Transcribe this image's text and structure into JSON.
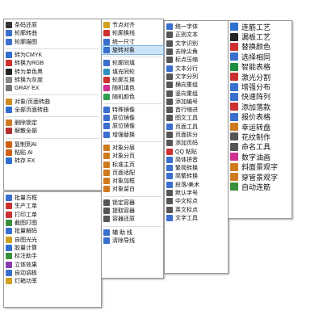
{
  "menu1": {
    "items": [
      {
        "label": "条码还原",
        "icon": "barcode-icon",
        "color": "#333333"
      },
      {
        "label": "轮廓转曲",
        "icon": "curve-icon",
        "color": "#3a6fcf"
      },
      {
        "label": "轮廓描图",
        "icon": "trace-icon",
        "color": "#3a6fcf"
      },
      {
        "label": "转为CMYK",
        "icon": "cmyk-icon",
        "color": "#2f6fd0"
      },
      {
        "label": "转换为RGB",
        "icon": "rgb-icon",
        "color": "#d03030"
      },
      {
        "label": "转为单色黑",
        "icon": "black-icon",
        "color": "#222222"
      },
      {
        "label": "转换为灰度",
        "icon": "gray-icon",
        "color": "#888888"
      },
      {
        "label": "GRAY EX",
        "icon": "gray-ex-icon",
        "color": "#777777"
      },
      {
        "label": "对象/页面转曲",
        "icon": "convert-icon",
        "color": "#d08a20"
      },
      {
        "label": "全部页面转曲",
        "icon": "pages-icon",
        "color": "#2f6fd0"
      },
      {
        "label": "删除锁定",
        "icon": "unlock-icon",
        "color": "#d07a20"
      },
      {
        "label": "解散全部",
        "icon": "ungroup-icon",
        "color": "#b03030"
      },
      {
        "label": "复制到AI",
        "icon": "ai-copy-icon",
        "color": "#d06010"
      },
      {
        "label": "粘贴  AI",
        "icon": "ai-paste-icon",
        "color": "#d06010"
      },
      {
        "label": "转存  EX",
        "icon": "export-icon",
        "color": "#2f6fd0"
      }
    ]
  },
  "menu1b": {
    "items": [
      {
        "label": "批量方框",
        "icon": "box-icon",
        "color": "#3a6fcf"
      },
      {
        "label": "生产工单",
        "icon": "order-icon",
        "color": "#cc3030"
      },
      {
        "label": "打印工单",
        "icon": "print-icon",
        "color": "#cc3030"
      },
      {
        "label": "截图打图",
        "icon": "screenshot-icon",
        "color": "#3a8f3a"
      },
      {
        "label": "批量解码",
        "icon": "decode-icon",
        "color": "#3a6fcf"
      },
      {
        "label": "自图光光",
        "icon": "light-icon",
        "color": "#d0a020"
      },
      {
        "label": "胶量计算",
        "icon": "calc-icon",
        "color": "#2f6fd0"
      },
      {
        "label": "标注助手",
        "icon": "annotate-icon",
        "color": "#3a8f3a"
      },
      {
        "label": "立体效果",
        "icon": "3d-icon",
        "color": "#8a3ab0"
      },
      {
        "label": "自动调板",
        "icon": "hourglass-icon",
        "color": "#3a6fcf"
      },
      {
        "label": "灯箱功率",
        "icon": "lamp-icon",
        "color": "#d0a020"
      }
    ]
  },
  "menu2": {
    "items": [
      {
        "label": "节点对齐",
        "icon": "node-align-icon",
        "color": "#d0a020"
      },
      {
        "label": "轮廓换线",
        "icon": "outline-icon",
        "color": "#cc3030"
      },
      {
        "label": "统一尺寸",
        "icon": "size-icon",
        "color": "#3a6fcf"
      },
      {
        "label": "旋转对象",
        "icon": "rotate-icon",
        "color": "#3a6fcf"
      },
      {
        "label": "轮廓同填",
        "icon": "fill-outline-icon",
        "color": "#3a6fcf"
      },
      {
        "label": "填充同轮",
        "icon": "fill-icon",
        "color": "#2f8fc0"
      },
      {
        "label": "轮廓互换",
        "icon": "swap-icon",
        "color": "#cc3030"
      },
      {
        "label": "随机填色",
        "icon": "random-fill-icon",
        "color": "#d03090"
      },
      {
        "label": "随机颜色",
        "icon": "random-color-icon",
        "color": "#30a050"
      },
      {
        "label": "特殊镜像",
        "icon": "mirror-icon",
        "color": "#3a6fcf"
      },
      {
        "label": "原位镜像",
        "icon": "mirror2-icon",
        "color": "#3a6fcf"
      },
      {
        "label": "原位镜像",
        "icon": "mirror3-icon",
        "color": "#3a6fcf"
      },
      {
        "label": "增强替换",
        "icon": "replace-icon",
        "color": "#3a6fcf"
      },
      {
        "label": "对象分层",
        "icon": "layer-icon",
        "color": "#d07a20"
      },
      {
        "label": "对象分页",
        "icon": "page-split-icon",
        "color": "#d07a20"
      },
      {
        "label": "标准主页",
        "icon": "home-page-icon",
        "color": "#d07a20"
      },
      {
        "label": "页面适配",
        "icon": "fit-icon",
        "color": "#d07a20"
      },
      {
        "label": "对象加框",
        "icon": "frame-icon",
        "color": "#d07a20"
      },
      {
        "label": "对象留白",
        "icon": "margin-icon",
        "color": "#d07a20"
      },
      {
        "label": "锁定容器",
        "icon": "lock-icon",
        "color": "#555555"
      },
      {
        "label": "提取容器",
        "icon": "extract-icon",
        "color": "#555555"
      },
      {
        "label": "容器还原",
        "icon": "restore-icon",
        "color": "#555555"
      },
      {
        "label": "辅 助 线",
        "icon": "guide-icon",
        "color": "#3a6fcf"
      },
      {
        "label": "清除导线",
        "icon": "clear-guide-icon",
        "color": "#3a6fcf"
      }
    ]
  },
  "menu3": {
    "items": [
      {
        "label": "统一字体",
        "icon": "font-icon",
        "color": "#3a6fcf"
      },
      {
        "label": "正则文本",
        "icon": "regex-icon",
        "color": "#555555"
      },
      {
        "label": "文字识别",
        "icon": "ocr-icon",
        "color": "#555555"
      },
      {
        "label": "去除尖角",
        "icon": "corner-icon",
        "color": "#555555"
      },
      {
        "label": "标点压缩",
        "icon": "punct-icon",
        "color": "#555555"
      },
      {
        "label": "文本分行",
        "icon": "split-line-icon",
        "color": "#3a6fcf"
      },
      {
        "label": "文字分列",
        "icon": "split-col-icon",
        "color": "#555555"
      },
      {
        "label": "横向重组",
        "icon": "h-group-icon",
        "color": "#555555"
      },
      {
        "label": "竖向重组",
        "icon": "v-group-icon",
        "color": "#555555"
      },
      {
        "label": "添加编号",
        "icon": "number-icon",
        "color": "#555555"
      },
      {
        "label": "首行缩进",
        "icon": "indent-icon",
        "color": "#555555"
      },
      {
        "label": "图文工具",
        "icon": "image-text-icon",
        "color": "#555555"
      },
      {
        "label": "页面工具",
        "icon": "page-tool-icon",
        "color": "#3a6fcf"
      },
      {
        "label": "页面拆分",
        "icon": "page-split2-icon",
        "color": "#555555"
      },
      {
        "label": "添加页码",
        "icon": "page-num-icon",
        "color": "#555555"
      },
      {
        "label": "QQ 粘贴",
        "icon": "qq-icon",
        "color": "#cc3030"
      },
      {
        "label": "简体拼音",
        "icon": "pinyin-icon",
        "color": "#3a6fcf"
      },
      {
        "label": "繁简转换",
        "icon": "trad-icon",
        "color": "#3a6fcf"
      },
      {
        "label": "简繁转换",
        "icon": "simp-icon",
        "color": "#3a6fcf"
      },
      {
        "label": "段落/美术",
        "icon": "paragraph-icon",
        "color": "#3a6fcf"
      },
      {
        "label": "默认字号",
        "icon": "fontsize-icon",
        "color": "#555555"
      },
      {
        "label": "中文标点",
        "icon": "cn-punct-icon",
        "color": "#555555"
      },
      {
        "label": "英文标点",
        "icon": "en-punct-icon",
        "color": "#555555"
      },
      {
        "label": "文字工具",
        "icon": "text-tool-icon",
        "color": "#3a6fcf"
      }
    ]
  },
  "menu4": {
    "items": [
      {
        "label": "连筋工艺",
        "icon": "link-icon",
        "color": "#2f6fd0"
      },
      {
        "label": "漏板工艺",
        "icon": "stencil-icon",
        "color": "#222222"
      },
      {
        "label": "替换颜色",
        "icon": "replace-color-icon",
        "color": "#d03030"
      },
      {
        "label": "选择相同",
        "icon": "select-same-icon",
        "color": "#3a6fcf"
      },
      {
        "label": "智能表格",
        "icon": "excel-icon",
        "color": "#1f8f3f"
      },
      {
        "label": "激光分割",
        "icon": "laser-icon",
        "color": "#cc3030"
      },
      {
        "label": "增强分布",
        "icon": "distribute-icon",
        "color": "#3a6fcf"
      },
      {
        "label": "快速阵列",
        "icon": "array-icon",
        "color": "#3a6fcf"
      },
      {
        "label": "添加落款",
        "icon": "seal-icon",
        "color": "#cc3030"
      },
      {
        "label": "报价表格",
        "icon": "quote-icon",
        "color": "#3a6fcf"
      },
      {
        "label": "幸运转盘",
        "icon": "wheel-icon",
        "color": "#d07a20"
      },
      {
        "label": "花纹制作",
        "icon": "pattern-icon",
        "color": "#555555"
      },
      {
        "label": "命名工具",
        "icon": "name-icon",
        "color": "#555555"
      },
      {
        "label": "数字油画",
        "icon": "paint-icon",
        "color": "#d03090"
      },
      {
        "label": "斜面景观字",
        "icon": "bevel-icon",
        "color": "#d07a20"
      },
      {
        "label": "穿管景观字",
        "icon": "tube-icon",
        "color": "#d07a20"
      },
      {
        "label": "自动连筋",
        "icon": "auto-link-icon",
        "color": "#3a8f3a"
      }
    ]
  }
}
